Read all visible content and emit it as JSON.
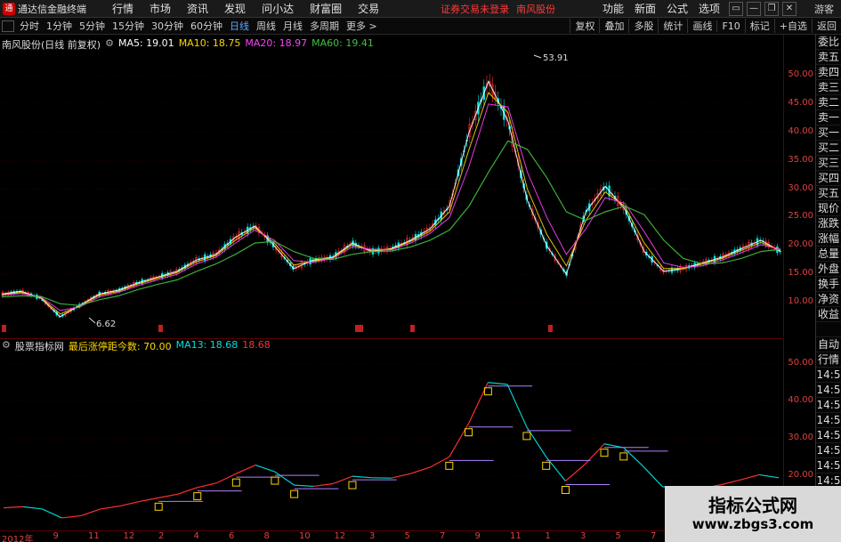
{
  "app": {
    "title": "通达信金融终端",
    "logo_glyph": "通"
  },
  "menu": [
    "行情",
    "市场",
    "资讯",
    "发现",
    "问小达",
    "财富圈",
    "交易"
  ],
  "notice": "证券交易未登录",
  "notice_stock": "南风股份",
  "right_menu": [
    "功能",
    "新面",
    "公式",
    "选项"
  ],
  "window_buttons": [
    "▭",
    "—",
    "❐",
    "✕"
  ],
  "guest": "游客",
  "periods": [
    "分时",
    "1分钟",
    "5分钟",
    "15分钟",
    "30分钟",
    "60分钟",
    "日线",
    "周线",
    "月线",
    "多周期",
    "更多 >"
  ],
  "active_period": "日线",
  "toolbar": [
    "复权",
    "叠加",
    "多股",
    "统计",
    "画线",
    "F10",
    "标记",
    "+自选",
    "返回"
  ],
  "main_legend": {
    "name": "南风股份(日线 前复权)",
    "ma5": "MA5: 19.01",
    "ma10": "MA10: 18.75",
    "ma20": "MA20: 18.97",
    "ma60": "MA60: 19.41"
  },
  "sub_legend": {
    "name": "股票指标网",
    "label": "最后涨停距今数: 70.00",
    "ma13": "MA13: 18.68",
    "value": "18.68"
  },
  "colors": {
    "ma5": "#ffffff",
    "ma10": "#ffd700",
    "ma20": "#ff40ff",
    "ma60": "#40c040",
    "axis": "#e04040",
    "up": "#ff3030",
    "down": "#00e0e0"
  },
  "main_y_ticks": [
    "50.00",
    "45.00",
    "40.00",
    "35.00",
    "30.00",
    "25.00",
    "20.00",
    "15.00",
    "10.00"
  ],
  "sub_y_ticks": [
    "50.00",
    "40.00",
    "30.00",
    "20.00"
  ],
  "annotations": {
    "high": "53.91",
    "low": "6.62"
  },
  "date_ticks": [
    "2012年",
    "9",
    "11",
    "12",
    "2",
    "4",
    "6",
    "8",
    "10",
    "12",
    "3",
    "5",
    "7",
    "9",
    "11",
    "1",
    "3",
    "5",
    "7",
    "9",
    "11",
    "1"
  ],
  "side_panel": [
    "委比",
    "卖五",
    "卖四",
    "卖三",
    "卖二",
    "卖一",
    "买一",
    "买二",
    "买三",
    "买四",
    "买五",
    "现价",
    "涨跌",
    "涨幅",
    "总量",
    "外盘",
    "换手",
    "净资",
    "收益",
    "",
    "自动",
    "行情",
    "14:5",
    "14:5",
    "14:5",
    "14:5",
    "14:5",
    "14:5",
    "14:5",
    "14:5"
  ],
  "watermark": {
    "title": "指标公式网",
    "url": "www.zbgs3.com"
  },
  "chart_data": {
    "type": "line",
    "y_axis": {
      "min": 6.62,
      "max": 53.91,
      "scale": "linear"
    },
    "series": [
      {
        "name": "MA5",
        "values": [
          11.5,
          12.0,
          10.8,
          7.5,
          9.5,
          11.5,
          12.2,
          13.5,
          14.5,
          15.5,
          17.5,
          18.5,
          21.5,
          23.5,
          20.0,
          16.0,
          17.5,
          18.0,
          20.5,
          19.0,
          19.5,
          21.0,
          23.0,
          27.0,
          40.0,
          49.0,
          42.0,
          28.0,
          20.0,
          15.0,
          26.0,
          30.5,
          26.5,
          19.0,
          15.5,
          16.0,
          17.0,
          18.0,
          19.5,
          21.0,
          19.0
        ]
      },
      {
        "name": "MA10",
        "values": [
          11.4,
          11.8,
          10.9,
          8.0,
          9.4,
          11.3,
          12.0,
          13.3,
          14.3,
          15.3,
          17.2,
          18.3,
          21.0,
          23.2,
          20.5,
          16.6,
          17.3,
          17.9,
          20.2,
          19.2,
          19.4,
          20.8,
          22.6,
          26.0,
          37.0,
          47.0,
          43.5,
          30.0,
          22.0,
          16.5,
          24.5,
          29.5,
          27.0,
          20.5,
          16.0,
          16.0,
          16.8,
          17.8,
          19.2,
          20.6,
          19.2
        ]
      },
      {
        "name": "MA20",
        "values": [
          11.3,
          11.6,
          11.0,
          8.6,
          9.2,
          11.0,
          11.8,
          13.0,
          14.0,
          15.0,
          16.8,
          18.0,
          20.5,
          22.8,
          21.0,
          17.4,
          17.1,
          17.8,
          19.8,
          19.4,
          19.3,
          20.5,
          22.2,
          25.0,
          34.0,
          45.0,
          44.5,
          33.0,
          25.0,
          18.5,
          23.0,
          28.5,
          27.5,
          22.5,
          17.0,
          16.2,
          16.5,
          17.5,
          18.8,
          20.2,
          19.4
        ]
      },
      {
        "name": "MA60",
        "values": [
          11.0,
          11.2,
          11.1,
          9.8,
          9.5,
          10.5,
          11.2,
          12.3,
          13.2,
          14.0,
          15.5,
          16.8,
          18.5,
          20.5,
          20.8,
          19.0,
          17.8,
          17.6,
          18.5,
          19.0,
          19.1,
          19.8,
          21.0,
          22.8,
          27.0,
          33.0,
          38.5,
          37.0,
          32.0,
          26.0,
          24.5,
          26.0,
          27.0,
          25.5,
          21.0,
          17.8,
          16.8,
          17.0,
          17.8,
          19.0,
          19.4
        ]
      }
    ]
  }
}
